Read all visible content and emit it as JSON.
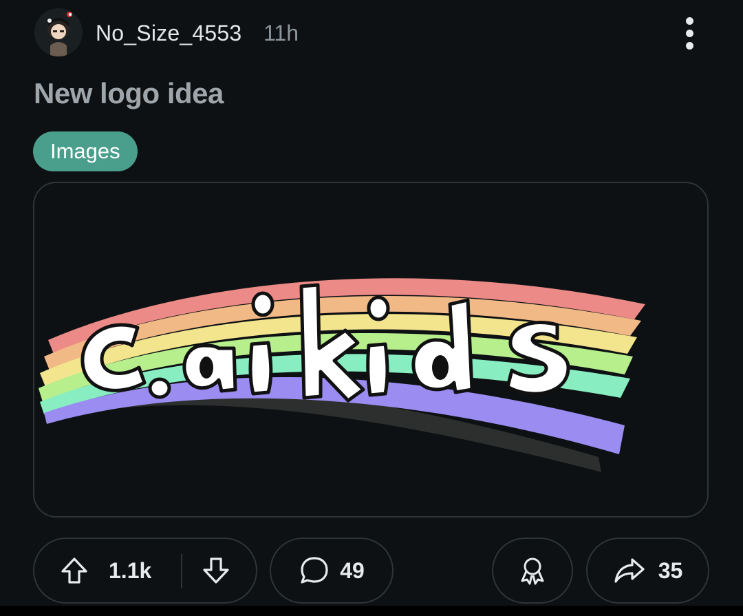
{
  "post": {
    "author": "No_Size_4553",
    "age": "11h",
    "title": "New logo idea",
    "flair": {
      "label": "Images",
      "color": "#4a9f8c"
    },
    "image": {
      "text": "c.ai kids",
      "rainbow_colors": [
        "#ec8a87",
        "#f1b985",
        "#f2e58e",
        "#b8ef8d",
        "#88eec2",
        "#9b8cf2"
      ]
    }
  },
  "actions": {
    "upvotes": "1.1k",
    "comments": "49",
    "shares": "35"
  },
  "icons": {
    "more": "more-vertical-icon",
    "upvote": "upvote-arrow-icon",
    "downvote": "downvote-arrow-icon",
    "comment": "comment-bubble-icon",
    "award": "award-ribbon-icon",
    "share": "share-arrow-icon"
  }
}
